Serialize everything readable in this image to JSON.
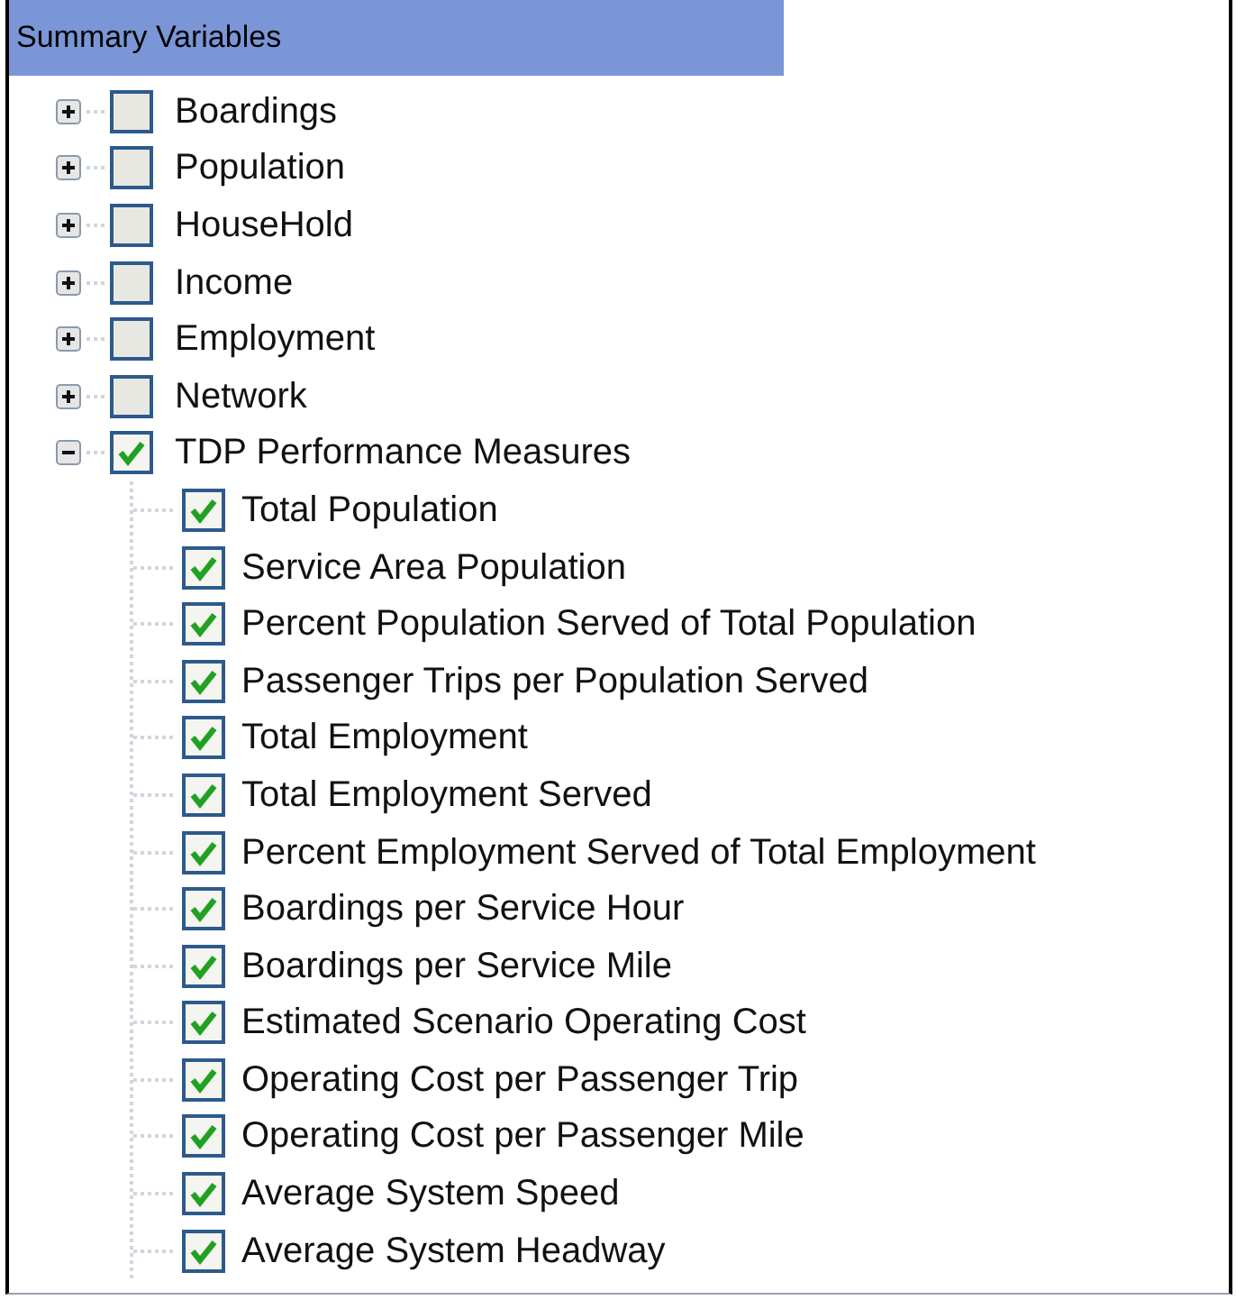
{
  "panel": {
    "title": "Summary Variables"
  },
  "tree": [
    {
      "label": "Boardings",
      "checked": false,
      "expanded": false
    },
    {
      "label": "Population",
      "checked": false,
      "expanded": false
    },
    {
      "label": "HouseHold",
      "checked": false,
      "expanded": false
    },
    {
      "label": "Income",
      "checked": false,
      "expanded": false
    },
    {
      "label": "Employment",
      "checked": false,
      "expanded": false
    },
    {
      "label": "Network",
      "checked": false,
      "expanded": false
    },
    {
      "label": "TDP Performance Measures",
      "checked": true,
      "expanded": true,
      "children": [
        {
          "label": "Total Population",
          "checked": true
        },
        {
          "label": "Service Area Population",
          "checked": true
        },
        {
          "label": "Percent Population Served of Total Population",
          "checked": true
        },
        {
          "label": "Passenger Trips per Population Served",
          "checked": true
        },
        {
          "label": "Total Employment",
          "checked": true
        },
        {
          "label": "Total Employment Served",
          "checked": true
        },
        {
          "label": "Percent Employment Served of Total Employment",
          "checked": true
        },
        {
          "label": "Boardings per Service Hour",
          "checked": true
        },
        {
          "label": "Boardings per Service Mile",
          "checked": true
        },
        {
          "label": "Estimated Scenario Operating Cost",
          "checked": true
        },
        {
          "label": "Operating Cost per Passenger Trip",
          "checked": true
        },
        {
          "label": "Operating Cost per Passenger Mile",
          "checked": true
        },
        {
          "label": "Average System Speed",
          "checked": true
        },
        {
          "label": "Average System Headway",
          "checked": true
        }
      ]
    }
  ]
}
